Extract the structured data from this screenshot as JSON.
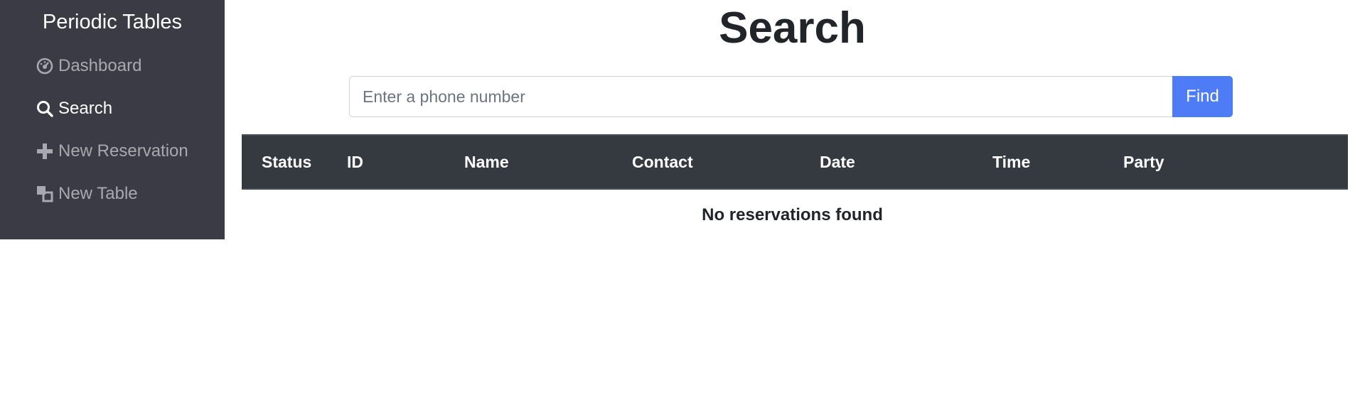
{
  "sidebar": {
    "brand": "Periodic Tables",
    "items": [
      {
        "label": "Dashboard",
        "icon": "dashboard-icon"
      },
      {
        "label": "Search",
        "icon": "search-icon"
      },
      {
        "label": "New Reservation",
        "icon": "plus-icon"
      },
      {
        "label": "New Table",
        "icon": "layers-icon"
      }
    ],
    "active_item": "Search"
  },
  "main": {
    "title": "Search",
    "search": {
      "placeholder": "Enter a phone number",
      "value": "",
      "button_label": "Find"
    },
    "table": {
      "columns": [
        "Status",
        "ID",
        "Name",
        "Contact",
        "Date",
        "Time",
        "Party"
      ],
      "rows": []
    },
    "empty_message": "No reservations found"
  },
  "colors": {
    "sidebar_bg": "#3a3b45",
    "accent": "#4e7cf6",
    "table_header_bg": "#343a40"
  }
}
